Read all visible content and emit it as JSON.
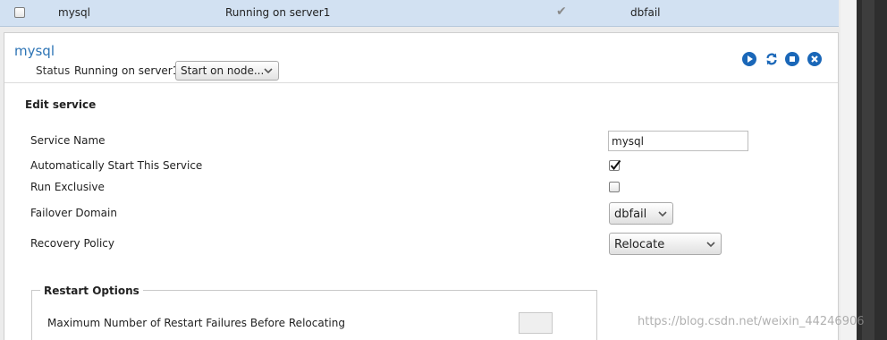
{
  "service_row": {
    "name": "mysql",
    "status": "Running on server1",
    "autostart_mark": "✔",
    "failover_domain": "dbfail"
  },
  "panel": {
    "title": "mysql",
    "status_label": "Status",
    "status_value": "Running on server1",
    "start_node_select": "Start on node...",
    "actions": [
      "start-icon",
      "restart-icon",
      "stop-icon",
      "delete-icon"
    ]
  },
  "edit": {
    "heading": "Edit service",
    "service_name_label": "Service Name",
    "service_name_value": "mysql",
    "autostart_label": "Automatically Start This Service",
    "autostart_checked": true,
    "exclusive_label": "Run Exclusive",
    "exclusive_checked": false,
    "failover_label": "Failover Domain",
    "failover_value": "dbfail",
    "recovery_label": "Recovery Policy",
    "recovery_value": "Relocate"
  },
  "restart_options": {
    "legend": "Restart Options",
    "max_failures_label": "Maximum Number of Restart Failures Before Relocating",
    "max_failures_value": ""
  },
  "watermark": "https://blog.csdn.net/weixin_44246906",
  "colors": {
    "title_blue": "#2d74b5",
    "row_selected": "#d2e1f2",
    "action_blue": "#1a67b8"
  }
}
